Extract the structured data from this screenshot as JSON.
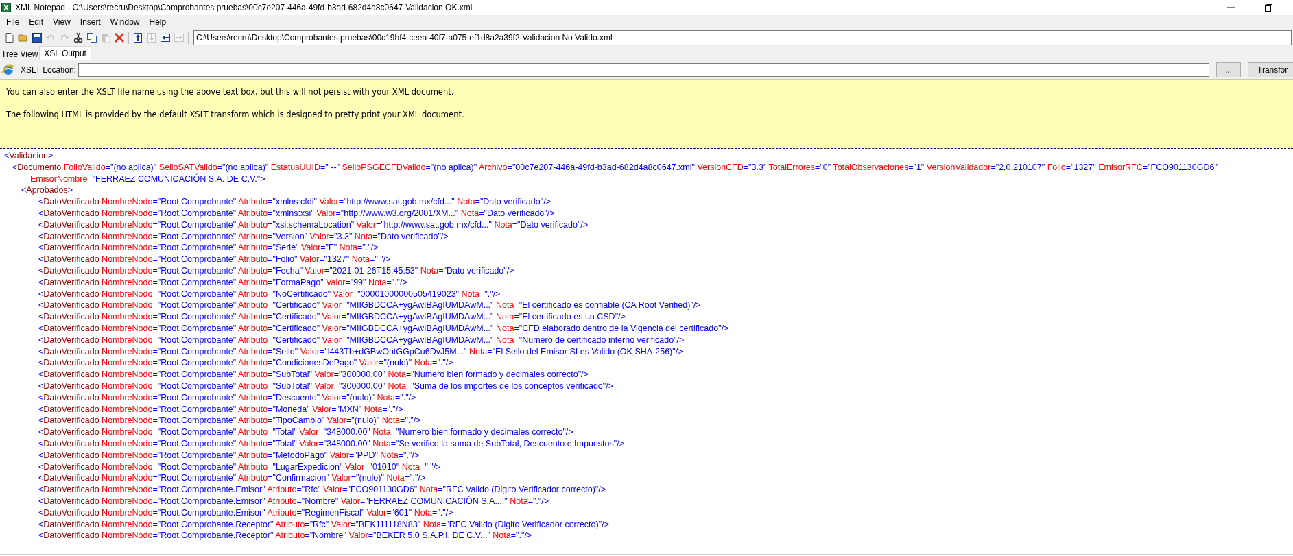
{
  "window": {
    "title": "XML Notepad - C:\\Users\\recru\\Desktop\\Comprobantes pruebas\\00c7e207-446a-49fd-b3ad-682d4a8c0647-Validacion OK.xml"
  },
  "menu": [
    "File",
    "Edit",
    "View",
    "Insert",
    "Window",
    "Help"
  ],
  "toolbar": [
    {
      "kind": "new",
      "disabled": false
    },
    {
      "kind": "open",
      "disabled": false
    },
    {
      "kind": "save",
      "disabled": false
    },
    {
      "kind": "undo",
      "disabled": true
    },
    {
      "kind": "redo",
      "disabled": true
    },
    {
      "kind": "cut",
      "disabled": false
    },
    {
      "kind": "copy",
      "disabled": false
    },
    {
      "kind": "paste",
      "disabled": true
    },
    {
      "kind": "delete",
      "disabled": false
    },
    {
      "kind": "nudge-up",
      "disabled": false
    },
    {
      "kind": "nudge-down",
      "disabled": true
    },
    {
      "kind": "nudge-left",
      "disabled": false
    },
    {
      "kind": "nudge-right",
      "disabled": true
    }
  ],
  "location_field": {
    "value": "C:\\Users\\recru\\Desktop\\Comprobantes pruebas\\00c19bf4-ceea-40f7-a075-ef1d8a2a39f2-Validacion No Valido.xml"
  },
  "tabs": [
    {
      "label": "Tree View",
      "selected": false
    },
    {
      "label": "XSL Output",
      "selected": true
    }
  ],
  "xslt_bar": {
    "label": "XSLT Location:",
    "browse_button": "...",
    "transform_button": "Transfor"
  },
  "info": [
    "You can also enter the XSLT file name using the above text box, but this will not persist with your XML document.",
    "The following HTML is provided by the default XSLT transform which is designed to pretty print your XML document."
  ],
  "xml": [
    {
      "text": "<Validacion>",
      "children": [
        {
          "text": "<Documento FolioValido=\"(no aplica)\" SelloSATValido=\"(no aplica)\" EstatusUUID=\" --\" SelloPSGECFDValido=\"(no aplica)\" Archivo=\"00c7e207-446a-49fd-b3ad-682d4a8c0647.xml\" VersionCFD=\"3.3\" TotalErrores=\"0\" TotalObservaciones=\"1\" VersionValidador=\"2.0.210107\" Folio=\"1327\" EmisorRFC=\"FCO901130GD6\" EmisorNombre=\"FERRAEZ COMUNICACIÓN S.A. DE C.V.\">",
          "children": [
            {
              "text": "<Aprobados>",
              "children": [
                {
                  "text": "<DatoVerificado NombreNodo=\"Root.Comprobante\" Atributo=\"xmlns:cfdi\" Valor=\"http://www.sat.gob.mx/cfd...\" Nota=\"Dato verificado\"/>"
                },
                {
                  "text": "<DatoVerificado NombreNodo=\"Root.Comprobante\" Atributo=\"xmlns:xsi\" Valor=\"http://www.w3.org/2001/XM...\" Nota=\"Dato verificado\"/>"
                },
                {
                  "text": "<DatoVerificado NombreNodo=\"Root.Comprobante\" Atributo=\"xsi:schemaLocation\" Valor=\"http://www.sat.gob.mx/cfd...\" Nota=\"Dato verificado\"/>"
                },
                {
                  "text": "<DatoVerificado NombreNodo=\"Root.Comprobante\" Atributo=\"Version\" Valor=\"3.3\" Nota=\"Dato verificado\"/>"
                },
                {
                  "text": "<DatoVerificado NombreNodo=\"Root.Comprobante\" Atributo=\"Serie\" Valor=\"F\" Nota=\".\"/>"
                },
                {
                  "text": "<DatoVerificado NombreNodo=\"Root.Comprobante\" Atributo=\"Folio\" Valor=\"1327\" Nota=\".\"/>"
                },
                {
                  "text": "<DatoVerificado NombreNodo=\"Root.Comprobante\" Atributo=\"Fecha\" Valor=\"2021-01-26T15:45:53\" Nota=\"Dato verificado\"/>"
                },
                {
                  "text": "<DatoVerificado NombreNodo=\"Root.Comprobante\" Atributo=\"FormaPago\" Valor=\"99\" Nota=\".\"/>"
                },
                {
                  "text": "<DatoVerificado NombreNodo=\"Root.Comprobante\" Atributo=\"NoCertificado\" Valor=\"00001000000505419023\" Nota=\".\"/>"
                },
                {
                  "text": "<DatoVerificado NombreNodo=\"Root.Comprobante\" Atributo=\"Certificado\" Valor=\"MIIGBDCCA+ygAwIBAgIUMDAwM...\" Nota=\"El certificado es confiable (CA Root Verified)\"/>"
                },
                {
                  "text": "<DatoVerificado NombreNodo=\"Root.Comprobante\" Atributo=\"Certificado\" Valor=\"MIIGBDCCA+ygAwIBAgIUMDAwM...\" Nota=\"El certificado es un CSD\"/>"
                },
                {
                  "text": "<DatoVerificado NombreNodo=\"Root.Comprobante\" Atributo=\"Certificado\" Valor=\"MIIGBDCCA+ygAwIBAgIUMDAwM...\" Nota=\"CFD elaborado dentro de la Vigencia del certificado\"/>"
                },
                {
                  "text": "<DatoVerificado NombreNodo=\"Root.Comprobante\" Atributo=\"Certificado\" Valor=\"MIIGBDCCA+ygAwIBAgIUMDAwM...\" Nota=\"Numero de certificado interno verificado\"/>"
                },
                {
                  "text": "<DatoVerificado NombreNodo=\"Root.Comprobante\" Atributo=\"Sello\" Valor=\"l443Tb+dGBwOntGGpCu6DvJ5M...\" Nota=\"El Sello del Emisor SI es Valido (OK SHA-256)\"/>"
                },
                {
                  "text": "<DatoVerificado NombreNodo=\"Root.Comprobante\" Atributo=\"CondicionesDePago\" Valor=\"(nulo)\" Nota=\".\"/>"
                },
                {
                  "text": "<DatoVerificado NombreNodo=\"Root.Comprobante\" Atributo=\"SubTotal\" Valor=\"300000.00\" Nota=\"Numero bien formado y decimales correcto\"/>"
                },
                {
                  "text": "<DatoVerificado NombreNodo=\"Root.Comprobante\" Atributo=\"SubTotal\" Valor=\"300000.00\" Nota=\"Suma de los importes de los conceptos verificado\"/>"
                },
                {
                  "text": "<DatoVerificado NombreNodo=\"Root.Comprobante\" Atributo=\"Descuento\" Valor=\"(nulo)\" Nota=\".\"/>"
                },
                {
                  "text": "<DatoVerificado NombreNodo=\"Root.Comprobante\" Atributo=\"Moneda\" Valor=\"MXN\" Nota=\".\"/>"
                },
                {
                  "text": "<DatoVerificado NombreNodo=\"Root.Comprobante\" Atributo=\"TipoCambio\" Valor=\"(nulo)\" Nota=\".\"/>"
                },
                {
                  "text": "<DatoVerificado NombreNodo=\"Root.Comprobante\" Atributo=\"Total\" Valor=\"348000.00\" Nota=\"Numero bien formado y decimales correcto\"/>"
                },
                {
                  "text": "<DatoVerificado NombreNodo=\"Root.Comprobante\" Atributo=\"Total\" Valor=\"348000.00\" Nota=\"Se verifico la suma de SubTotal, Descuento e Impuestos\"/>"
                },
                {
                  "text": "<DatoVerificado NombreNodo=\"Root.Comprobante\" Atributo=\"MetodoPago\" Valor=\"PPD\" Nota=\".\"/>"
                },
                {
                  "text": "<DatoVerificado NombreNodo=\"Root.Comprobante\" Atributo=\"LugarExpedicion\" Valor=\"01010\" Nota=\".\"/>"
                },
                {
                  "text": "<DatoVerificado NombreNodo=\"Root.Comprobante\" Atributo=\"Confirmacion\" Valor=\"(nulo)\" Nota=\".\"/>"
                },
                {
                  "text": "<DatoVerificado NombreNodo=\"Root.Comprobante.Emisor\" Atributo=\"Rfc\" Valor=\"FCO901130GD6\" Nota=\"RFC Valido (Digito Verificador correcto)\"/>"
                },
                {
                  "text": "<DatoVerificado NombreNodo=\"Root.Comprobante.Emisor\" Atributo=\"Nombre\" Valor=\"FERRAEZ COMUNICACIÓN S.A....\" Nota=\".\"/>"
                },
                {
                  "text": "<DatoVerificado NombreNodo=\"Root.Comprobante.Emisor\" Atributo=\"RegimenFiscal\" Valor=\"601\" Nota=\".\"/>"
                },
                {
                  "text": "<DatoVerificado NombreNodo=\"Root.Comprobante.Receptor\" Atributo=\"Rfc\" Valor=\"BEK111118N83\" Nota=\"RFC Valido (Digito Verificador correcto)\"/>"
                },
                {
                  "text": "<DatoVerificado NombreNodo=\"Root.Comprobante.Receptor\" Atributo=\"Nombre\" Valor=\"BEKER 5.0 S.A.P.I. DE C.V...\" Nota=\".\"/>"
                }
              ]
            }
          ]
        }
      ]
    }
  ]
}
